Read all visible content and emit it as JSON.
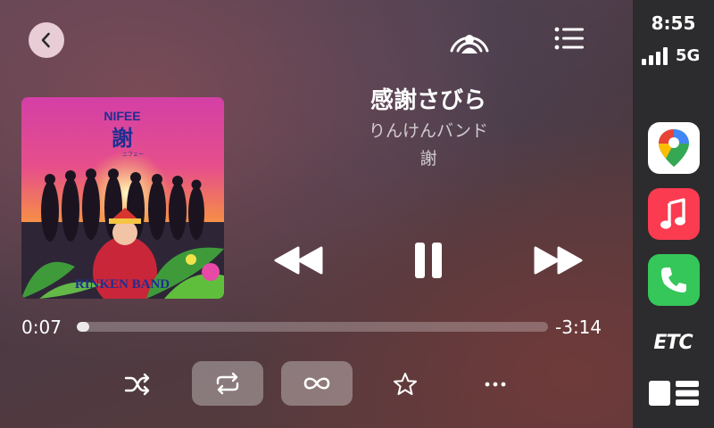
{
  "now_playing": {
    "song_title": "感謝さびら",
    "artist": "りんけんバンド",
    "album": "謝",
    "elapsed": "0:07",
    "remaining": "-3:14",
    "progress": 0.027
  },
  "album_art": {
    "top_text": "NIFEE",
    "kanji": "謝",
    "small_text": "ニフェー",
    "band_text": "RINKEN BAND"
  },
  "status": {
    "time": "8:55",
    "network": "5G"
  },
  "dock": {
    "etc_label": "ETC"
  },
  "colors": {
    "music_red": "#fb3b50",
    "phone_green": "#35c759",
    "maps_white": "#ffffff"
  }
}
